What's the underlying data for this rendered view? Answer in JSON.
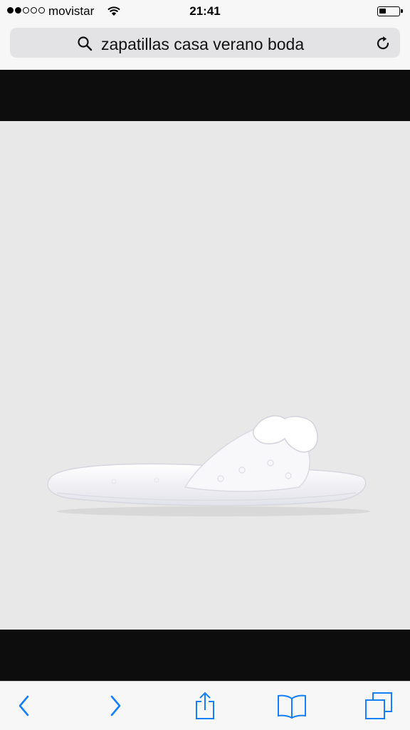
{
  "status_bar": {
    "signal": "signal-dots-2-of-5",
    "carrier": "movistar",
    "time": "21:41",
    "wifi_icon": "wifi-icon",
    "battery_icon": "battery-icon",
    "battery_level": 0.25
  },
  "address_bar": {
    "search_icon": "search-icon",
    "query": "zapatillas casa verano boda",
    "reload_icon": "reload-icon"
  },
  "content": {
    "image_description_icon": "white-slipper-product-image",
    "background_color": "#e8e8e8",
    "band_color": "#0d0d0d"
  },
  "toolbar": {
    "back_icon": "chevron-left-icon",
    "forward_icon": "chevron-right-icon",
    "share_icon": "share-icon",
    "bookmarks_icon": "book-icon",
    "tabs_icon": "tabs-icon",
    "accent_color": "#147efb"
  }
}
